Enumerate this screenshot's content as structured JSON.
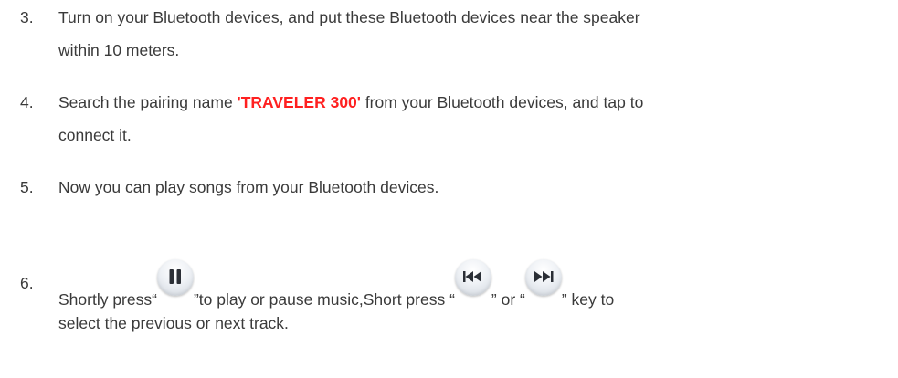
{
  "steps": [
    {
      "number": "3.",
      "line1": "Turn on your Bluetooth devices, and put these Bluetooth devices near the speaker",
      "line2": "within 10 meters."
    },
    {
      "number": "4.",
      "line1_before": "Search the pairing name ",
      "line1_highlight": "'TRAVELER 300'",
      "line1_after": " from your Bluetooth devices, and tap to",
      "line2": "connect it."
    },
    {
      "number": "5.",
      "line1": "Now you can play songs from your Bluetooth devices."
    },
    {
      "number": "6.",
      "part_a": "Shortly press“",
      "part_b": "”to play or pause music,Short press “",
      "part_c": "” or “",
      "part_d": "” key to",
      "line2": "select the previous or next track."
    }
  ],
  "icons": {
    "pause": "pause-icon",
    "previous": "previous-track-icon",
    "next": "next-track-icon"
  },
  "colors": {
    "text": "#3a3a3a",
    "highlight": "#ff2020"
  }
}
